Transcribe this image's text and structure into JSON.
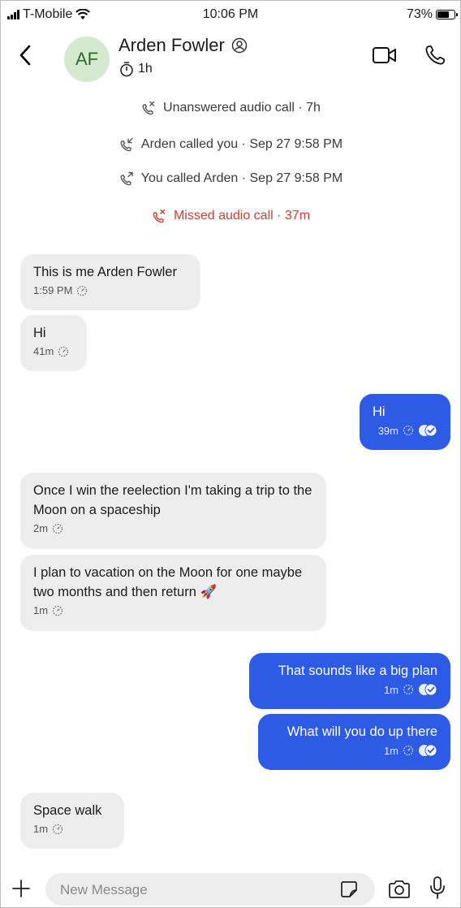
{
  "status_bar": {
    "carrier": "T-Mobile",
    "time": "10:06 PM",
    "battery_percent": "73%",
    "battery_level": 0.73
  },
  "header": {
    "avatar_initials": "AF",
    "contact_name": "Arden Fowler",
    "disappearing_timer": "1h",
    "colors": {
      "avatar_bg": "#d4e9cf",
      "avatar_text": "#2f6b2a"
    },
    "icons": {
      "back": "chevron-left-icon",
      "profile": "person-circle-icon",
      "timer": "timer-icon",
      "video": "video-call-icon",
      "call": "phone-icon"
    }
  },
  "call_log": [
    {
      "icon": "missed-call-icon",
      "text": "Unanswered audio call · 7h",
      "missed": false
    },
    {
      "icon": "incoming-call-icon",
      "text": "Arden called you · Sep 27 9:58 PM",
      "missed": false
    },
    {
      "icon": "outgoing-call-icon",
      "text": "You called Arden · Sep 27 9:58 PM",
      "missed": false
    },
    {
      "icon": "missed-call-icon",
      "text": "Missed audio call · 37m",
      "missed": true
    }
  ],
  "messages": [
    {
      "direction": "incoming",
      "text": "This is me Arden Fowler",
      "time": "1:59 PM"
    },
    {
      "direction": "incoming",
      "text": "Hi",
      "time": "41m"
    },
    {
      "direction": "outgoing",
      "text": "Hi",
      "time": "39m"
    },
    {
      "direction": "incoming",
      "text": "Once I win the reelection I'm taking a trip to the Moon on a spaceship",
      "time": "2m"
    },
    {
      "direction": "incoming",
      "text": "I plan to vacation on the Moon for one maybe two months and then return 🚀",
      "time": "1m"
    },
    {
      "direction": "outgoing",
      "text": "That sounds like a big plan",
      "time": "1m"
    },
    {
      "direction": "outgoing",
      "text": "What will you do up there",
      "time": "1m"
    },
    {
      "direction": "incoming",
      "text": "Space walk",
      "time": "1m"
    }
  ],
  "composer": {
    "placeholder": "New Message",
    "value": "",
    "icons": {
      "attach": "plus-icon",
      "sticker": "sticker-icon",
      "camera": "camera-icon",
      "mic": "microphone-icon"
    }
  },
  "colors": {
    "outgoing_bubble": "#2e5be5",
    "incoming_bubble": "#ededed",
    "missed_call": "#d93a2f"
  }
}
